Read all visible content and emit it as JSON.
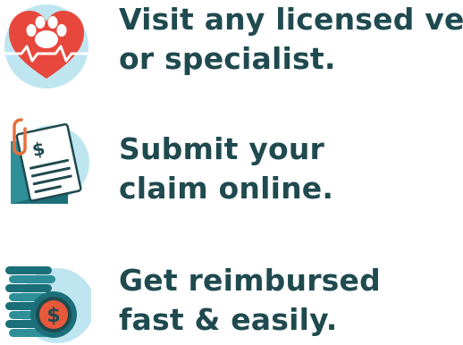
{
  "colors": {
    "text": "#1f4a4f",
    "circle_light": "#bfe6f0",
    "heart_red": "#e7473c",
    "teal_dark": "#1b6f78",
    "teal_mid": "#2e8f98",
    "teal_light": "#4fb3b9",
    "paper": "#ffffff",
    "coin_orange": "#e8583a",
    "clip_orange": "#e8703a"
  },
  "steps": [
    {
      "icon": "paw-heart-icon",
      "line1": "Visit any licensed vet",
      "line2": "or specialist."
    },
    {
      "icon": "claim-document-icon",
      "line1": "Submit your",
      "line2": "claim online.",
      "symbol": "$"
    },
    {
      "icon": "coin-stack-icon",
      "line1": "Get reimbursed",
      "line2": "fast & easily.",
      "symbol": "$"
    }
  ]
}
